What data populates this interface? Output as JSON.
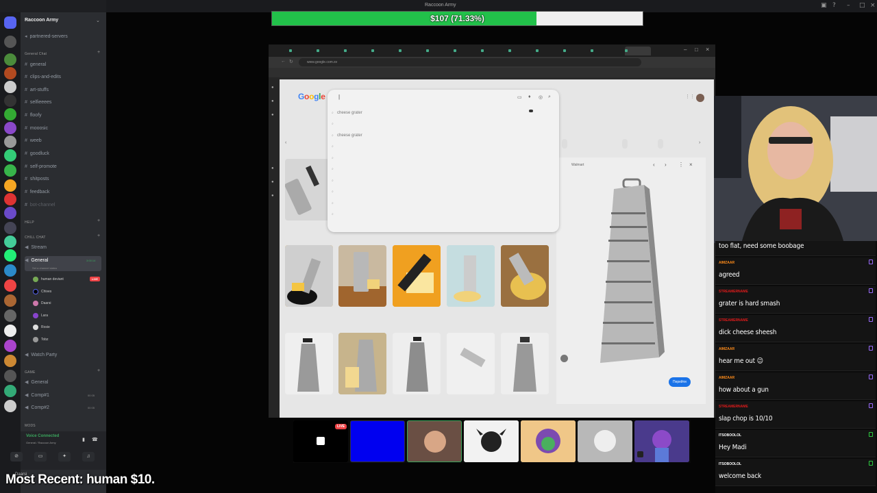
{
  "window": {
    "title": "Raccoon Army",
    "subtitle_hint": ""
  },
  "discord": {
    "server_name": "Raccoon Army",
    "channels_top": [
      {
        "name": "partnered-servers",
        "icon": "megaphone-icon"
      }
    ],
    "category_general_chat": "General Chat",
    "general_chat_channels": [
      "general",
      "clips-and-edits",
      "art-stuffs",
      "selfieeees",
      "floofy",
      "mooosic",
      "weeb",
      "goodluck",
      "self-promote",
      "shitposts",
      "feedback",
      "bot-channel"
    ],
    "category_help": "HELP",
    "category_chill_chat": "CHILL CHAT",
    "chill_channels": [
      "Stream",
      "General"
    ],
    "active_voice_channel": "General",
    "active_voice_status": "Set a channel status",
    "active_voice_time": "3:00:14",
    "voice_users": [
      {
        "name": "human deviant",
        "live": true
      },
      {
        "name": "Chives",
        "live": false
      },
      {
        "name": "Daarsi",
        "live": false
      },
      {
        "name": "Lara",
        "live": false
      },
      {
        "name": "Rosie",
        "live": false
      },
      {
        "name": "Tobz",
        "live": false
      }
    ],
    "live_label": "LIVE",
    "watch_party": "Watch Party",
    "category_game": "GAME",
    "game_channels": [
      {
        "name": "General",
        "count": ""
      },
      {
        "name": "Comp#1",
        "count": "00 05"
      },
      {
        "name": "Comp#2",
        "count": "00 05"
      }
    ],
    "category_mods": "MODS",
    "voice_connected_title": "Voice Connected",
    "voice_connected_sub": "General / Raccoon Army",
    "user_bar_name": "Daarsi"
  },
  "donation": {
    "text": "$107 (71.33%)",
    "progress_fraction": 0.7133,
    "fill_color": "#22c14a"
  },
  "browser": {
    "address": "www.google.com.sv",
    "tabs": [
      "",
      "",
      "",
      "",
      "",
      "",
      "",
      "",
      "",
      "",
      "",
      "",
      ""
    ],
    "bookmarks": [
      "",
      "",
      "",
      "",
      "",
      "",
      "",
      "",
      "",
      "",
      "",
      ""
    ]
  },
  "google": {
    "logo_letters": [
      "G",
      "o",
      "o",
      "g",
      "l",
      "e"
    ],
    "search_value": "|",
    "tooltip": "",
    "suggestions": [
      "cheese grater",
      "",
      "cheese grater",
      "",
      "",
      "",
      "",
      "",
      "",
      ""
    ],
    "preview_source": "Walmart",
    "preview_title": "",
    "preview_button": "Перейти"
  },
  "chat": [
    {
      "user": "",
      "text": "too flat, need some boobage",
      "user_color": "#b0b0b0"
    },
    {
      "user": "AIMZAAR",
      "text": "agreed",
      "user_color": "#ff8c1a"
    },
    {
      "user": "STREAMERNAME",
      "text": "grater is hard smash",
      "user_color": "#e01b1b"
    },
    {
      "user": "STREAMERNAME",
      "text": "dick cheese sheesh",
      "user_color": "#e01b1b"
    },
    {
      "user": "AIMZAAR",
      "text": "hear me out 😉",
      "user_color": "#ff8c1a"
    },
    {
      "user": "AIMZAAR",
      "text": "how about a gun",
      "user_color": "#ff8c1a"
    },
    {
      "user": "STREAMERNAME",
      "text": "slap chop is 10/10",
      "user_color": "#e01b1b"
    },
    {
      "user": "ITSOBOOLOL",
      "text": "Hey Madi",
      "user_color": "#ffffff"
    },
    {
      "user": "ITSOBOOLOL",
      "text": "welcome back",
      "user_color": "#ffffff"
    }
  ],
  "thumbnails": {
    "live_label": "LIVE"
  },
  "most_recent": "Most Recent: human $10."
}
